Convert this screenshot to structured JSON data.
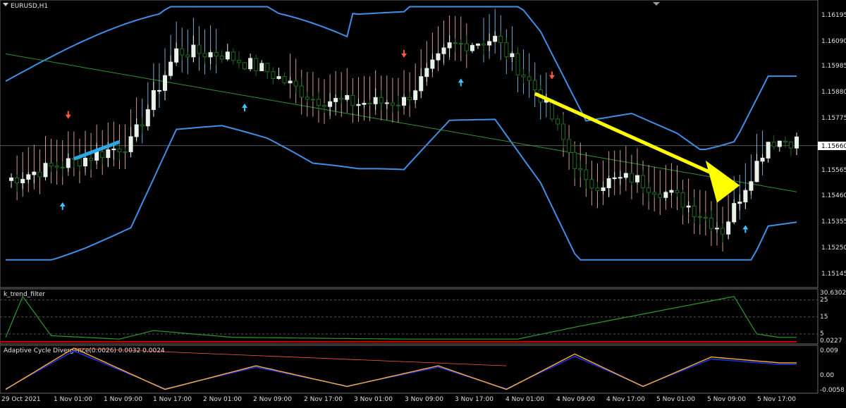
{
  "window": {
    "symbol_title": "EURUSD,H1"
  },
  "colors": {
    "background": "#000000",
    "axis": "#9a9a9a",
    "grid_text": "#d8d8d8",
    "bull_candle": "#e8f2ea",
    "bear_candle": "#1f6b1f",
    "bollinger": "#3f8fe6",
    "ma_green": "#2f8f2f",
    "cloud_red": "#f4b7a8",
    "cloud_blue": "#8ec5ee",
    "arrow_yellow": "#ffff00",
    "arrow_blue": "#2ba8e6",
    "signal_red": "#ff5a3c",
    "signal_blue": "#3fc0ff",
    "trend_line": "#2c9b2c",
    "trend_zero": "#d40000",
    "acd_orange": "#ffb030",
    "acd_blue": "#2030e0"
  },
  "price_axis": {
    "labels": [
      "1.16195",
      "1.16090",
      "1.15985",
      "1.15880",
      "1.15775",
      "1.15660",
      "1.15565",
      "1.15460",
      "1.15355",
      "1.15250",
      "1.15145"
    ],
    "current_price": "1.15660"
  },
  "time_axis": {
    "labels": [
      "29 Oct 2021",
      "1 Nov 01:00",
      "1 Nov 09:00",
      "1 Nov 17:00",
      "2 Nov 01:00",
      "2 Nov 09:00",
      "2 Nov 17:00",
      "3 Nov 01:00",
      "3 Nov 09:00",
      "3 Nov 17:00",
      "4 Nov 01:00",
      "4 Nov 09:00",
      "4 Nov 17:00",
      "5 Nov 01:00",
      "5 Nov 09:00",
      "5 Nov 17:00"
    ]
  },
  "panels": {
    "trend_filter": {
      "title": "k_trend_filter",
      "axis_labels": [
        "30.6302",
        "25",
        "15",
        "5",
        "0.0227"
      ]
    },
    "acd": {
      "title": "Adaptive Cycle Divergence(0.0026) 0.0032 0.0024",
      "axis_labels": [
        "0.009",
        "0.00",
        "-0.0058"
      ]
    }
  },
  "chart_data": [
    {
      "type": "line",
      "title": "EURUSD,H1",
      "ylim": [
        1.151,
        1.1623
      ],
      "x_range": [
        "29 Oct 2021",
        "5 Nov 2021"
      ],
      "series": [
        {
          "x": [
            0,
            6,
            14,
            22,
            30,
            38,
            46,
            54,
            62,
            70,
            78,
            86,
            94,
            102,
            110,
            118,
            126,
            134
          ],
          "close": [
            1.1552,
            1.1556,
            1.1561,
            1.1567,
            1.1604,
            1.1603,
            1.1596,
            1.1585,
            1.1583,
            1.1584,
            1.1606,
            1.1609,
            1.1586,
            1.155,
            1.1553,
            1.1545,
            1.1532,
            1.1568
          ]
        }
      ],
      "annotations": [
        "up-arrow",
        "down-arrow",
        "current-price 1.15660"
      ]
    },
    {
      "type": "line",
      "title": "k_trend_filter",
      "ylim": [
        0.0227,
        30.6302
      ],
      "series": [
        {
          "x": [
            0,
            3,
            8,
            20,
            26,
            40,
            70,
            90,
            100,
            128,
            132,
            136
          ],
          "values": [
            3,
            27,
            4,
            2,
            7,
            3,
            2,
            2,
            9,
            27,
            5,
            3
          ]
        }
      ]
    },
    {
      "type": "line",
      "title": "Adaptive Cycle Divergence",
      "ylim": [
        -0.0058,
        0.009
      ],
      "series": [
        {
          "x": [
            0,
            12,
            28,
            44,
            60,
            76,
            88,
            100,
            112,
            124,
            136
          ],
          "values": [
            -0.005,
            0.009,
            -0.005,
            0.003,
            -0.004,
            0.003,
            -0.005,
            0.007,
            -0.004,
            0.006,
            0.004
          ]
        }
      ]
    }
  ]
}
